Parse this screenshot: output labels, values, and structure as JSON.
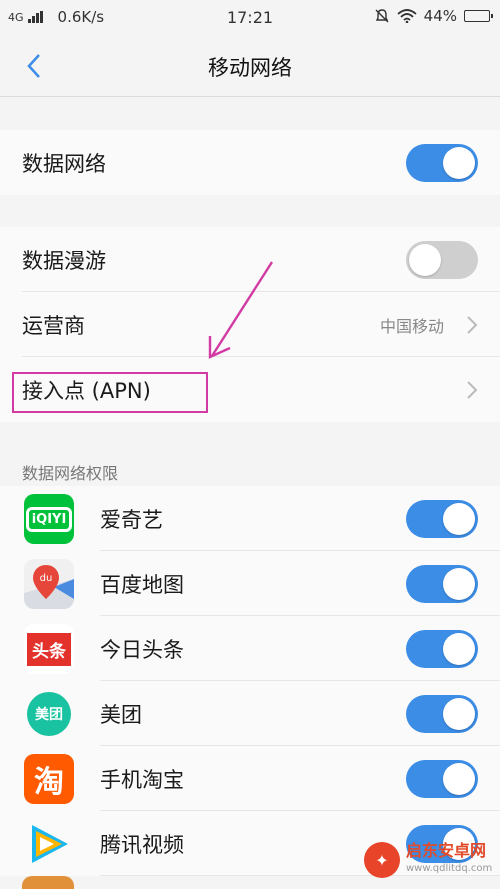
{
  "status_bar": {
    "network": "4G",
    "speed": "0.6K/s",
    "time": "17:21",
    "battery": "44%"
  },
  "header": {
    "title": "移动网络",
    "back_icon": "chevron-left-icon"
  },
  "settings": {
    "data_network": {
      "label": "数据网络",
      "enabled": true
    },
    "data_roaming": {
      "label": "数据漫游",
      "enabled": false
    },
    "carrier": {
      "label": "运营商",
      "value": "中国移动"
    },
    "apn": {
      "label": "接入点 (APN)"
    }
  },
  "permissions": {
    "section_title": "数据网络权限",
    "apps": [
      {
        "name": "爱奇艺",
        "icon": "iqiyi-icon",
        "icon_text": "iQIYI",
        "enabled": true
      },
      {
        "name": "百度地图",
        "icon": "baidu-map-icon",
        "icon_text": "du",
        "enabled": true
      },
      {
        "name": "今日头条",
        "icon": "toutiao-icon",
        "icon_text": "头条",
        "enabled": true
      },
      {
        "name": "美团",
        "icon": "meituan-icon",
        "icon_text": "美团",
        "enabled": true
      },
      {
        "name": "手机淘宝",
        "icon": "taobao-icon",
        "icon_text": "淘",
        "enabled": true
      },
      {
        "name": "腾讯视频",
        "icon": "tencent-video-icon",
        "enabled": true
      }
    ]
  },
  "watermark": {
    "name": "启东安卓网",
    "url": "www.qdlitdq.com"
  },
  "colors": {
    "accent": "#3b8de6",
    "toggle_off": "#cfcfcf",
    "annotation": "#d23ba3",
    "background": "#f4f4f4"
  }
}
